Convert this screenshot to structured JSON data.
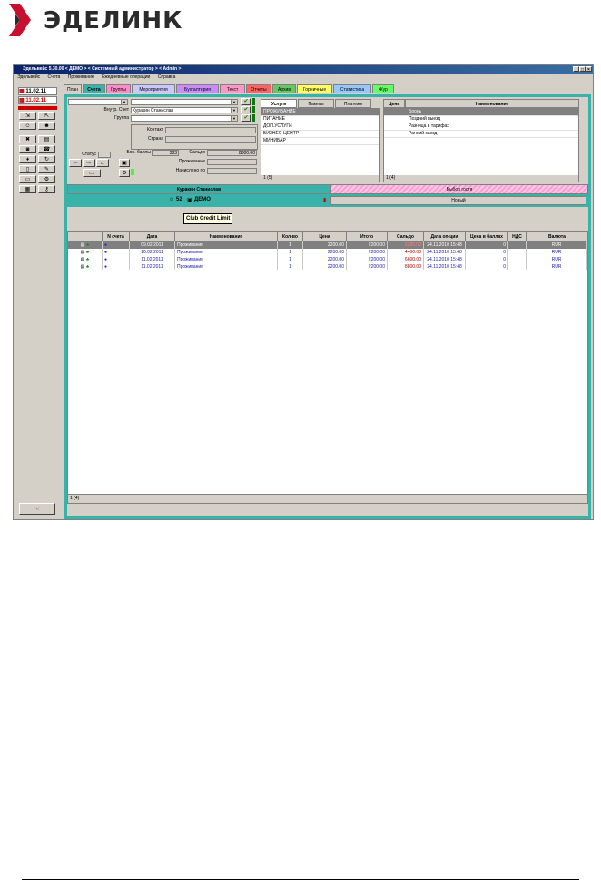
{
  "brand": {
    "name": "ЭДЕЛИНК",
    "colors": {
      "logo_red": "#c8102e",
      "logo_dark": "#2b2b2b"
    }
  },
  "window": {
    "title": "Эдельвейс 5.30.00 < ДЕМО > < Системный администратор > < Admin >",
    "controls": [
      "_",
      "□",
      "×"
    ]
  },
  "menu": [
    "Эдельвейс",
    "Счета",
    "Проживание",
    "Ежедневные операции",
    "Справка"
  ],
  "tabs": [
    {
      "label": "План",
      "color": "#d4d0c8"
    },
    {
      "label": "Счета",
      "color": "#39b3aa"
    },
    {
      "label": "Группы",
      "color": "#ff8cc8"
    },
    {
      "label": "Мероприятия",
      "color": "#c8c8ff"
    },
    {
      "label": "Бухгалтерия",
      "color": "#c88cff"
    },
    {
      "label": "Текст",
      "color": "#ff96c8"
    },
    {
      "label": "Отчеты",
      "color": "#ff6464"
    },
    {
      "label": "Архив",
      "color": "#64c864"
    },
    {
      "label": "Горничные",
      "color": "#ffff64"
    },
    {
      "label": "Статистика",
      "color": "#96c8ff"
    },
    {
      "label": "Жур",
      "color": "#64ff64"
    }
  ],
  "left": {
    "date1": "11.02.11",
    "date2": "11.02.11"
  },
  "form": {
    "account_label": "Внутр. Счет",
    "account_value": "Куракин Станислав",
    "group_label": "Группа",
    "contact_label": "Контакт",
    "country_label": "Страна",
    "status_label": "Статус",
    "bonus_label": "Бон. баллы",
    "bonus_value": "383",
    "saldo_label": "Сальдо",
    "saldo_value": "8800.00",
    "acc_label": "Проживание",
    "charged_label": "Начислено по"
  },
  "tooltip": "Club Credit Limit",
  "services": {
    "tabs": [
      "Услуги",
      "Пакеты",
      "Платежи"
    ],
    "items": [
      "ПРОЖИВАНИЕ",
      "ПИТАНИЕ",
      "ДОП.УСЛУГИ",
      "БИЗНЕС-ЦЕНТР",
      "МИНИБАР"
    ],
    "footer": "1 (5)"
  },
  "prices": {
    "headers": [
      "Цена",
      "Наименование"
    ],
    "items": [
      "Бронь",
      "Поздний выезд",
      "Разница в тарифах",
      "Ранний заезд"
    ],
    "footer": "1 (4)"
  },
  "guest_bar": {
    "name": "Куракин Станислав",
    "select": "Выбор гостя",
    "room": "52",
    "company": "ДЕМО",
    "state": "Новый"
  },
  "grid": {
    "headers": [
      "",
      "N счета",
      "Дата",
      "Наименование",
      "Кол-во",
      "Цена",
      "Итого",
      "Сальдо",
      "Дата оп-ции",
      "Цена в баллах",
      "НДС",
      "Валюта"
    ],
    "rows": [
      {
        "date": "09.02.2011",
        "name": "Проживание",
        "qty": "1",
        "price": "2200.00",
        "total": "2200.00",
        "saldo": "2200.00",
        "opdate": "24.11.2010 15:48",
        "points": "0",
        "vat": "",
        "cur": "RUR"
      },
      {
        "date": "10.02.2011",
        "name": "Проживание",
        "qty": "1",
        "price": "2200.00",
        "total": "2200.00",
        "saldo": "4400.00",
        "opdate": "24.11.2010 15:48",
        "points": "0",
        "vat": "",
        "cur": "RUR"
      },
      {
        "date": "11.02.2011",
        "name": "Проживание",
        "qty": "1",
        "price": "2200.00",
        "total": "2200.00",
        "saldo": "6600.00",
        "opdate": "24.11.2010 15:48",
        "points": "0",
        "vat": "",
        "cur": "RUR"
      },
      {
        "date": "11.02.2011",
        "name": "Проживание",
        "qty": "1",
        "price": "2200.00",
        "total": "2200.00",
        "saldo": "8800.00",
        "opdate": "24.11.2010 15:48",
        "points": "0",
        "vat": "",
        "cur": "RUR"
      }
    ],
    "footer": "1 (4)"
  }
}
